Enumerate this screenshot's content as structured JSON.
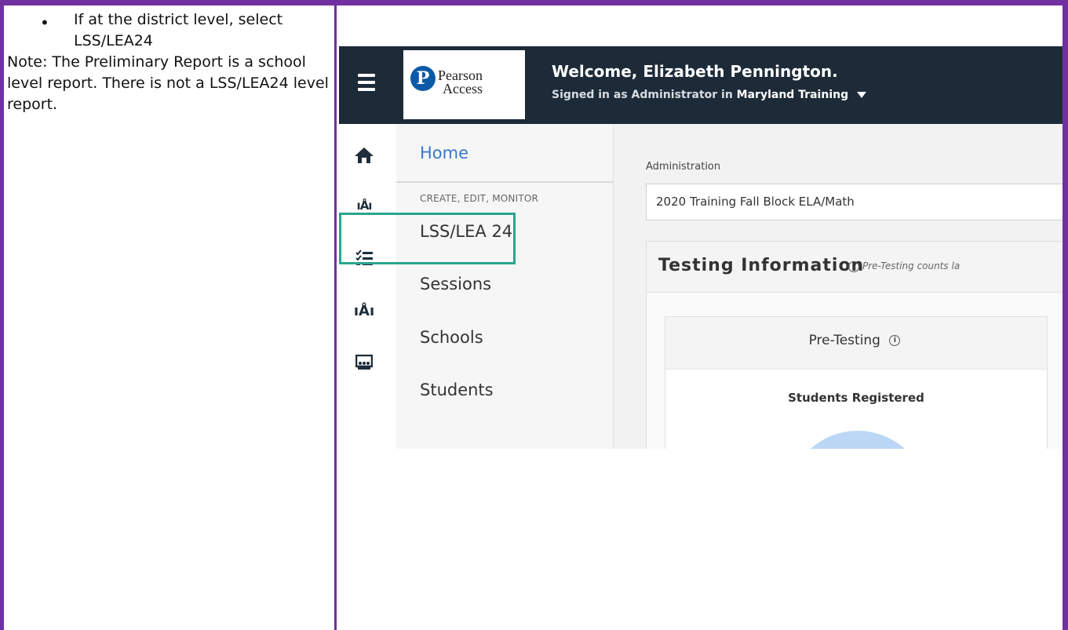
{
  "instructions": {
    "bullet": "If at the district level, select LSS/LEA24",
    "note": "Note: The Preliminary Report is a school level report. There is not a LSS/LEA24 level report."
  },
  "app": {
    "logo_line1": "Pearson",
    "logo_line2": "Access",
    "welcome": "Welcome, Elizabeth Pennington.",
    "signed_in_prefix": "Signed in as Administrator in",
    "organization": "Maryland Training"
  },
  "nav": {
    "home": "Home",
    "section": "CREATE, EDIT, MONITOR",
    "items": [
      {
        "label": "LSS/LEA 24",
        "icon": "district-icon"
      },
      {
        "label": "Sessions",
        "icon": "checklist-icon"
      },
      {
        "label": "Schools",
        "icon": "school-icon"
      },
      {
        "label": "Students",
        "icon": "students-icon"
      }
    ]
  },
  "main": {
    "administration_label": "Administration",
    "administration_value": "2020 Training Fall Block ELA/Math",
    "testing_title": "Testing Information",
    "testing_note": "Pre-Testing counts la",
    "pre_testing_title": "Pre-Testing",
    "students_registered": "Students Registered"
  },
  "colors": {
    "frame": "#7030a0",
    "topbar": "#1d2a38",
    "highlight": "#2aa58c",
    "home_link": "#3a78c9"
  }
}
